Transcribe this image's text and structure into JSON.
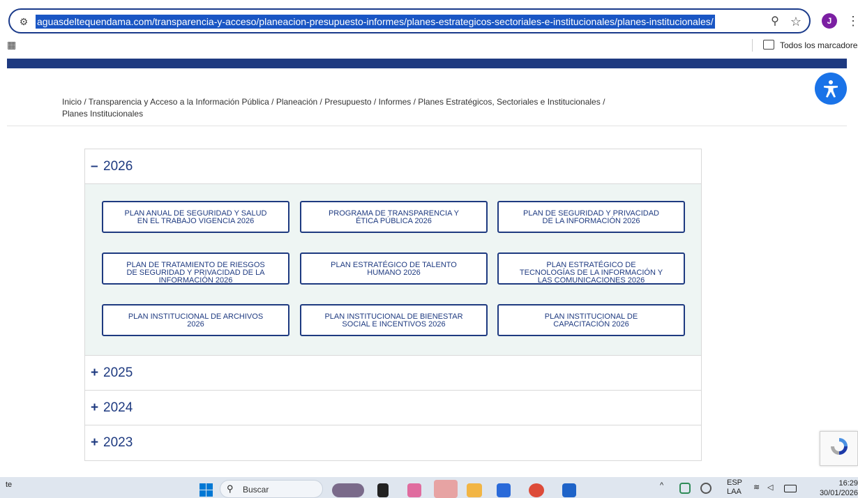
{
  "browser": {
    "url": "aguasdeltequendama.com/transparencia-y-acceso/planeacion-presupuesto-informes/planes-estrategicos-sectoriales-e-institucionales/planes-institucionales/",
    "profile_initial": "J",
    "bookmarks_label": "Todos los marcadores"
  },
  "breadcrumb": {
    "line1": "Inicio / Transparencia y Acceso a la Información Pública / Planeación / Presupuesto / Informes / Planes Estratégicos, Sectoriales e Institucionales /",
    "line2": "Planes Institucionales"
  },
  "accordion": {
    "open_section": {
      "sign": "–",
      "year": "2026"
    },
    "buttons": [
      [
        "PLAN ANUAL DE SEGURIDAD Y SALUD",
        "EN EL TRABAJO VIGENCIA 2026"
      ],
      [
        "PROGRAMA DE TRANSPARENCIA Y",
        "ÉTICA PÚBLICA 2026"
      ],
      [
        "PLAN DE SEGURIDAD Y PRIVACIDAD",
        "DE LA INFORMACIÓN 2026"
      ],
      [
        "PLAN DE TRATAMIENTO DE RIESGOS",
        "DE SEGURIDAD Y PRIVACIDAD DE LA",
        "INFORMACIÓN 2026"
      ],
      [
        "PLAN ESTRATÉGICO DE TALENTO",
        "HUMANO 2026"
      ],
      [
        "PLAN ESTRATÉGICO DE",
        "TECNOLOGÍAS DE LA INFORMACIÓN Y",
        "LAS COMUNICACIONES 2026"
      ],
      [
        "PLAN INSTITUCIONAL DE ARCHIVOS",
        "2026"
      ],
      [
        "PLAN INSTITUCIONAL DE BIENESTAR",
        "SOCIAL E INCENTIVOS 2026"
      ],
      [
        "PLAN INSTITUCIONAL DE",
        "CAPACITACIÓN 2026"
      ]
    ],
    "closed_sections": [
      {
        "sign": "+",
        "year": "2025"
      },
      {
        "sign": "+",
        "year": "2024"
      },
      {
        "sign": "+",
        "year": "2023"
      }
    ]
  },
  "taskbar": {
    "left_text": "te",
    "search_placeholder": "Buscar",
    "lang_top": "ESP",
    "lang_bottom": "LAA",
    "time": "16:29",
    "date": "30/01/2026"
  },
  "colors": {
    "navy": "#1e3a80",
    "panel_bg": "#eef5f3",
    "a11y_blue": "#1a73e8",
    "url_highlight": "#1a56c4"
  }
}
